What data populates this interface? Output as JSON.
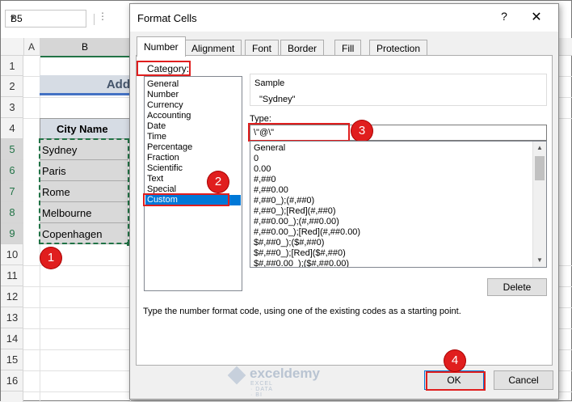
{
  "excel": {
    "namebox": "B5",
    "fx_dots": "⋮",
    "columns": [
      "A",
      "B"
    ],
    "rows": [
      "1",
      "2",
      "3",
      "4",
      "5",
      "6",
      "7",
      "8",
      "9",
      "10",
      "11",
      "12",
      "13",
      "14",
      "15",
      "16"
    ],
    "title_partial": "Add",
    "header": "City Name",
    "cities": [
      "Sydney",
      "Paris",
      "Rome",
      "Melbourne",
      "Copenhagen"
    ]
  },
  "dialog": {
    "title": "Format Cells",
    "help": "?",
    "close": "✕",
    "tabs": [
      "Number",
      "Alignment",
      "Font",
      "Border",
      "Fill",
      "Protection"
    ],
    "category_label": "Category:",
    "categories": [
      "General",
      "Number",
      "Currency",
      "Accounting",
      "Date",
      "Time",
      "Percentage",
      "Fraction",
      "Scientific",
      "Text",
      "Special",
      "Custom"
    ],
    "selected_category": "Custom",
    "sample_label": "Sample",
    "sample_value": "\"Sydney\"",
    "type_label": "Type:",
    "type_value": "\\\"@\\\"",
    "type_list": [
      "General",
      "0",
      "0.00",
      "#,##0",
      "#,##0.00",
      "#,##0_);(#,##0)",
      "#,##0_);[Red](#,##0)",
      "#,##0.00_);(#,##0.00)",
      "#,##0.00_);[Red](#,##0.00)",
      "$#,##0_);($#,##0)",
      "$#,##0_);[Red]($#,##0)",
      "$#,##0.00_);($#,##0.00)"
    ],
    "delete_label": "Delete",
    "hint": "Type the number format code, using one of the existing codes as a starting point.",
    "ok_label": "OK",
    "cancel_label": "Cancel"
  },
  "callouts": [
    "1",
    "2",
    "3",
    "4"
  ],
  "watermark": {
    "brand": "exceldemy",
    "tag": "EXCEL · DATA · BI"
  },
  "colors": {
    "accent": "#0078d7",
    "callout": "#e01e1e",
    "excel_green": "#217346"
  }
}
